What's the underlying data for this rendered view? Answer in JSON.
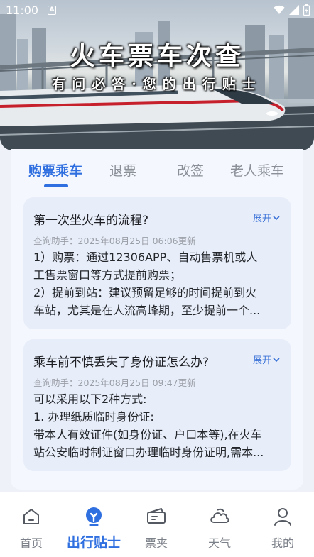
{
  "status_bar": {
    "time": "11:00",
    "notif_letter": "A"
  },
  "hero": {
    "title": "火车票车次查",
    "subtitle": "有问必答·您的出行贴士"
  },
  "tabs": [
    {
      "label": "购票乘车",
      "active": true
    },
    {
      "label": "退票",
      "active": false
    },
    {
      "label": "改签",
      "active": false
    },
    {
      "label": "老人乘车",
      "active": false
    }
  ],
  "cards": [
    {
      "question": "第一次坐火车的流程?",
      "expand_label": "展开",
      "meta": "查询助手：2025年08月25日 06:06更新",
      "lines": [
        "1）购票：通过12306APP、自动售票机或人",
        "工售票窗口等方式提前购票；",
        "2）提前到站：建议预留足够的时间提前到火",
        "车站，尤其是在人流高峰期，至少提前一个..."
      ]
    },
    {
      "question": "乘车前不慎丢失了身份证怎么办?",
      "expand_label": "展开",
      "meta": "查询助手：2025年08月25日 09:47更新",
      "lines": [
        "可以采用以下2种方式:",
        "1. 办理纸质临时身份证:",
        "带本人有效证件(如身份证、户口本等),在火车",
        "站公安临时制证窗口办理临时身份证明,需本..."
      ]
    }
  ],
  "nav": [
    {
      "label": "首页",
      "icon": "home-icon",
      "active": false
    },
    {
      "label": "出行贴士",
      "icon": "tips-icon",
      "active": true
    },
    {
      "label": "票夹",
      "icon": "ticket-icon",
      "active": false
    },
    {
      "label": "天气",
      "icon": "weather-icon",
      "active": false
    },
    {
      "label": "我的",
      "icon": "user-icon",
      "active": false
    }
  ],
  "colors": {
    "accent": "#2f6fe0",
    "card_bg": "#e8eef9",
    "inactive": "#8a8f98"
  }
}
